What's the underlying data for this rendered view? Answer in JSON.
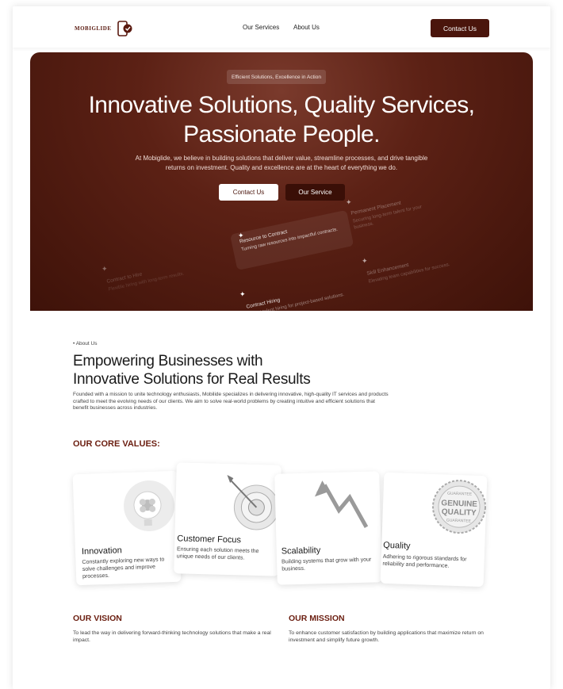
{
  "nav": {
    "logo_text": "MOBIGLIDE",
    "links": [
      "Our Services",
      "About Us"
    ],
    "cta": "Contact Us"
  },
  "hero": {
    "badge": "Efficient Solutions, Excellence in Action",
    "title_line1": "Innovative Solutions, Quality Services,",
    "title_line2": "Passionate People.",
    "subtitle": "At Mobiglide, we believe in building solutions that deliver value, streamline processes, and drive tangible returns on investment. Quality and excellence are at the heart of everything we do.",
    "btn_primary": "Contact Us",
    "btn_secondary": "Our Service",
    "cards": [
      {
        "title": "Resource to Contract",
        "desc": "Turning raw resources into impactful contracts."
      },
      {
        "title": "Permanent Placement",
        "desc": "Securing long-term talent for your business."
      },
      {
        "title": "Contract to Hire",
        "desc": "Flexible hiring with long-term results."
      },
      {
        "title": "Skill Enhancement",
        "desc": "Elevating team capabilities for success."
      },
      {
        "title": "Contract Hiring",
        "desc": "Expert talent hiring for project-based solutions."
      }
    ]
  },
  "about": {
    "tag": "• About Us",
    "title_line1": "Empowering Businesses with",
    "title_line2": "Innovative Solutions for Real Results",
    "text": "Founded with a mission to unite technology enthusiasts, Mobilide specializes in delivering innovative, high-quality IT services and products crafted to meet the evolving needs of our clients. We aim to solve real-world problems by creating intuitive and efficient solutions that benefit businesses across industries."
  },
  "core_values": {
    "title": "OUR CORE VALUES:",
    "items": [
      {
        "title": "Innovation",
        "desc": "Constantly exploring new ways to solve challenges and improve processes."
      },
      {
        "title": "Customer Focus",
        "desc": "Ensuring each solution meets the unique needs of our clients."
      },
      {
        "title": "Scalability",
        "desc": "Building systems that grow with your business."
      },
      {
        "title": "Quality",
        "desc": "Adhering to rigorous standards for reliability and performance."
      }
    ],
    "seal_text": [
      "GUARANTEE",
      "GENUINE",
      "QUALITY",
      "GUARANTEE"
    ]
  },
  "vision": {
    "title": "OUR VISION",
    "text": "To lead the way in delivering forward-thinking technology solutions that make a real impact."
  },
  "mission": {
    "title": "OUR MISSION",
    "text": "To enhance customer satisfaction by building applications that maximize return on investment and simplify future growth."
  },
  "colors": {
    "brand": "#4a150c",
    "accent": "#6b1e10",
    "hero_bg": "#5c2115"
  }
}
